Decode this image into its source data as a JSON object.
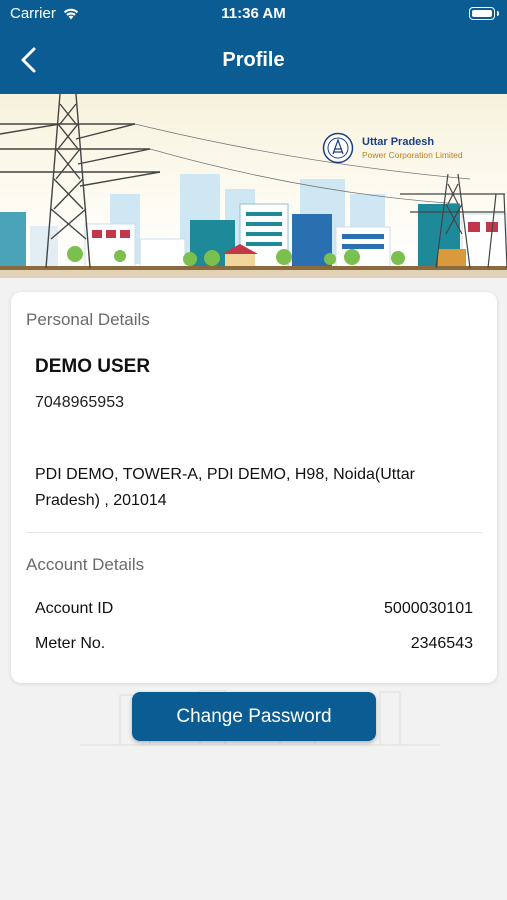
{
  "status_bar": {
    "carrier": "Carrier",
    "time": "11:36 AM"
  },
  "nav": {
    "title": "Profile",
    "back_icon": "chevron-left-icon"
  },
  "banner": {
    "brand_line1": "Uttar Pradesh",
    "brand_line2": "Power Corporation Limited"
  },
  "personal": {
    "section_title": "Personal Details",
    "name": "DEMO USER",
    "phone": "7048965953",
    "address": "PDI DEMO, TOWER-A, PDI DEMO, H98, Noida(Uttar Pradesh) , 201014"
  },
  "account": {
    "section_title": "Account Details",
    "account_id_label": "Account ID",
    "account_id_value": "5000030101",
    "meter_label": "Meter No.",
    "meter_value": "2346543"
  },
  "actions": {
    "change_password_label": "Change Password"
  },
  "colors": {
    "primary": "#0a5c93",
    "background": "#f2f2f2",
    "card": "#ffffff"
  }
}
